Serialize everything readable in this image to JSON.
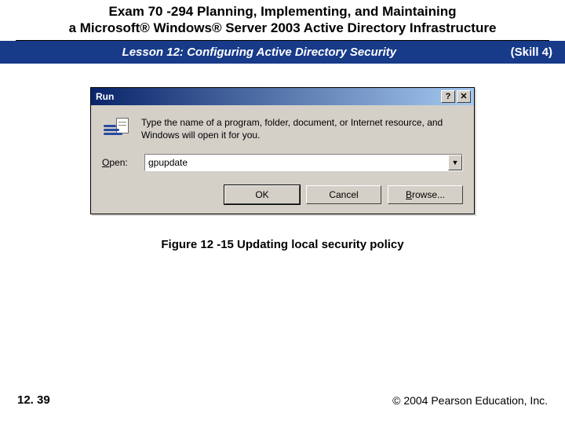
{
  "header": {
    "title_line1": "Exam 70 -294 Planning, Implementing, and Maintaining",
    "title_line2": "a Microsoft® Windows® Server 2003 Active Directory Infrastructure"
  },
  "subheader": {
    "lesson": "Lesson 12: Configuring Active Directory Security",
    "skill": "(Skill 4)"
  },
  "run_dialog": {
    "title": "Run",
    "help_glyph": "?",
    "close_glyph": "✕",
    "instruction": "Type the name of a program, folder, document, or Internet resource, and Windows will open it for you.",
    "open_label_u": "O",
    "open_label_rest": "pen:",
    "input_value": "gpupdate",
    "drop_glyph": "▼",
    "buttons": {
      "ok": "OK",
      "cancel": "Cancel",
      "browse_u": "B",
      "browse_rest": "rowse..."
    }
  },
  "figure_caption": "Figure 12 -15 Updating local security policy",
  "footer": {
    "page": "12. 39",
    "copyright": "© 2004 Pearson Education, Inc."
  }
}
